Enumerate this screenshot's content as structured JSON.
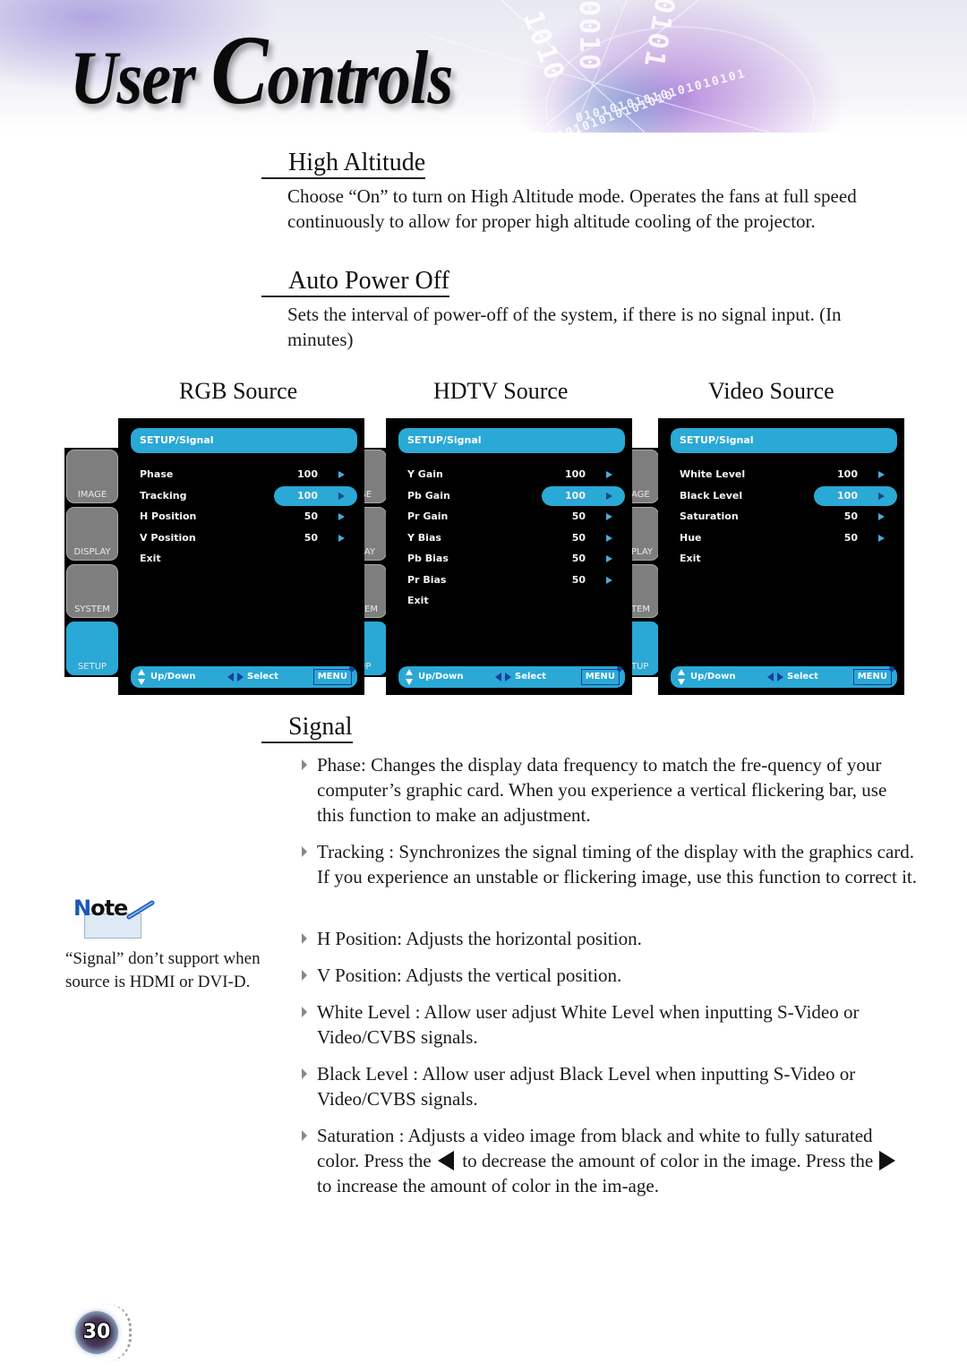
{
  "header": {
    "title_part1": "User ",
    "title_big_c": "C",
    "title_part2": "ontrols",
    "banner_digits": [
      "1010",
      "0010",
      "0101",
      "01010101010101010101",
      "1010101010101010"
    ]
  },
  "sections": {
    "high_altitude": {
      "title": "High Altitude",
      "body": "Choose “On” to turn on High Altitude mode. Operates the fans at full speed continuously to allow for proper high altitude cooling of the projector."
    },
    "auto_power_off": {
      "title": "Auto Power Off",
      "body": "Sets the interval of power-off of the system, if there is no signal input. (In minutes)"
    },
    "signal": {
      "title": "Signal"
    }
  },
  "source_labels": [
    "RGB Source",
    "HDTV Source",
    "Video Source"
  ],
  "osd": {
    "header": "SETUP/Signal",
    "tabs": [
      "IMAGE",
      "DISPLAY",
      "SYSTEM",
      "SETUP"
    ],
    "partial_tabs": [
      "GE",
      "LAY",
      "TEM",
      "UP"
    ],
    "partial_tabs_video": [
      "AGE",
      "PLAY",
      "TEM",
      "TUP"
    ],
    "footer": {
      "updown": "Up/Down",
      "select": "Select",
      "menu": "MENU"
    },
    "panels": [
      {
        "source": "RGB Source",
        "rows": [
          {
            "name": "Phase",
            "value": "100",
            "selected": false
          },
          {
            "name": "Tracking",
            "value": "100",
            "selected": true
          },
          {
            "name": "H Position",
            "value": "50",
            "selected": false
          },
          {
            "name": "V Position",
            "value": "50",
            "selected": false
          },
          {
            "name": "Exit",
            "value": null,
            "selected": false
          }
        ]
      },
      {
        "source": "HDTV Source",
        "rows": [
          {
            "name": "Y Gain",
            "value": "100",
            "selected": false
          },
          {
            "name": "Pb Gain",
            "value": "100",
            "selected": true
          },
          {
            "name": "Pr Gain",
            "value": "50",
            "selected": false
          },
          {
            "name": "Y Bias",
            "value": "50",
            "selected": false
          },
          {
            "name": "Pb Bias",
            "value": "50",
            "selected": false
          },
          {
            "name": "Pr Bias",
            "value": "50",
            "selected": false
          },
          {
            "name": "Exit",
            "value": null,
            "selected": false
          }
        ]
      },
      {
        "source": "Video Source",
        "rows": [
          {
            "name": "White Level",
            "value": "100",
            "selected": false
          },
          {
            "name": "Black Level",
            "value": "100",
            "selected": true
          },
          {
            "name": "Saturation",
            "value": "50",
            "selected": false
          },
          {
            "name": "Hue",
            "value": "50",
            "selected": false
          },
          {
            "name": "Exit",
            "value": null,
            "selected": false
          }
        ]
      }
    ],
    "colors": {
      "accent": "#2aa8d6",
      "tab_inactive": "#7e7e7e",
      "background": "#000000",
      "menu_border": "#1a3f9e"
    }
  },
  "signal_items": [
    "Phase: Changes the display data frequency to match the fre-quency of your computer’s graphic card. When you experience a vertical flickering bar, use this function to make an adjustment.",
    "Tracking : Synchronizes the signal timing of the display with the graphics card. If you experience an unstable or flickering image, use this function to correct it.",
    "H Position: Adjusts the horizontal position.",
    "V Position: Adjusts the vertical position.",
    "White Level : Allow user adjust White Level when inputting S-Video or Video/CVBS signals.",
    "Black Level : Allow user adjust Black Level when inputting S-Video or Video/CVBS signals."
  ],
  "saturation_item": {
    "part1": "Saturation : Adjusts a video image from black and white to fully saturated color. Press the ",
    "part2": " to decrease the amount of color in the image. Press the ",
    "part3": " to increase the amount of color in the im-age."
  },
  "note": {
    "label_n": "N",
    "label_rest": "ote",
    "text": "“Signal” don’t support when source is HDMI or DVI-D."
  },
  "page_number": "30"
}
